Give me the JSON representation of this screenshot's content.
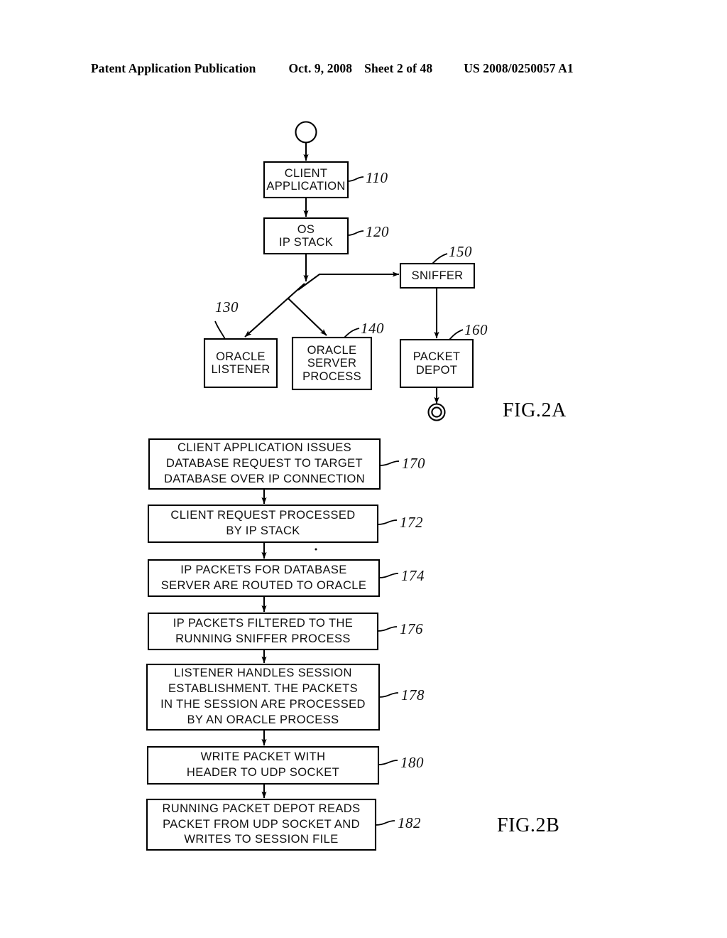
{
  "header": {
    "publication": "Patent Application Publication",
    "date": "Oct. 9, 2008",
    "sheet": "Sheet 2 of 48",
    "doc_number": "US 2008/0250057 A1"
  },
  "fig2a": {
    "caption": "FIG.2A",
    "nodes": [
      {
        "id": "start",
        "label": "",
        "ref": "",
        "shape": "circle"
      },
      {
        "id": "client",
        "label": "CLIENT\nAPPLICATION",
        "ref": "110",
        "shape": "box"
      },
      {
        "id": "ipstack",
        "label": "OS\nIP  STACK",
        "ref": "120",
        "shape": "box"
      },
      {
        "id": "listener",
        "label": "ORACLE\nLISTENER",
        "ref": "130",
        "shape": "box"
      },
      {
        "id": "server",
        "label": "ORACLE\nSERVER\nPROCESS",
        "ref": "140",
        "shape": "box"
      },
      {
        "id": "sniffer",
        "label": "SNIFFER",
        "ref": "150",
        "shape": "box"
      },
      {
        "id": "depot",
        "label": "PACKET\nDEPOT",
        "ref": "160",
        "shape": "box"
      },
      {
        "id": "end",
        "label": "",
        "ref": "",
        "shape": "double-circle"
      }
    ],
    "labels": {
      "client_line1": "CLIENT",
      "client_line2": "APPLICATION",
      "ipstack_line1": "OS",
      "ipstack_line2": "IP  STACK",
      "listener_line1": "ORACLE",
      "listener_line2": "LISTENER",
      "server_line1": "ORACLE",
      "server_line2": "SERVER",
      "server_line3": "PROCESS",
      "sniffer_line1": "SNIFFER",
      "depot_line1": "PACKET",
      "depot_line2": "DEPOT"
    },
    "refs": {
      "client": "110",
      "ipstack": "120",
      "listener": "130",
      "server": "140",
      "sniffer": "150",
      "depot": "160"
    }
  },
  "fig2b": {
    "caption": "FIG.2B",
    "steps": [
      {
        "ref": "170",
        "lines": [
          "CLIENT  APPLICATION  ISSUES",
          "DATABASE  REQUEST  TO  TARGET",
          "DATABASE  OVER  IP  CONNECTION"
        ]
      },
      {
        "ref": "172",
        "lines": [
          "CLIENT  REQUEST  PROCESSED",
          "BY  IP  STACK"
        ]
      },
      {
        "ref": "174",
        "lines": [
          "IP  PACKETS  FOR  DATABASE",
          "SERVER  ARE  ROUTED  TO  ORACLE"
        ]
      },
      {
        "ref": "176",
        "lines": [
          "IP  PACKETS  FILTERED  TO  THE",
          "RUNNING  SNIFFER  PROCESS"
        ]
      },
      {
        "ref": "178",
        "lines": [
          "LISTENER  HANDLES  SESSION",
          "ESTABLISHMENT.  THE  PACKETS",
          "IN  THE  SESSION  ARE  PROCESSED",
          "BY  AN  ORACLE  PROCESS"
        ]
      },
      {
        "ref": "180",
        "lines": [
          "WRITE  PACKET  WITH",
          "HEADER  TO  UDP  SOCKET"
        ]
      },
      {
        "ref": "182",
        "lines": [
          "RUNNING  PACKET  DEPOT  READS",
          "PACKET  FROM  UDP  SOCKET  AND",
          "WRITES  TO  SESSION  FILE"
        ]
      }
    ]
  },
  "colors": {
    "ink": "#000000",
    "paper": "#ffffff"
  }
}
